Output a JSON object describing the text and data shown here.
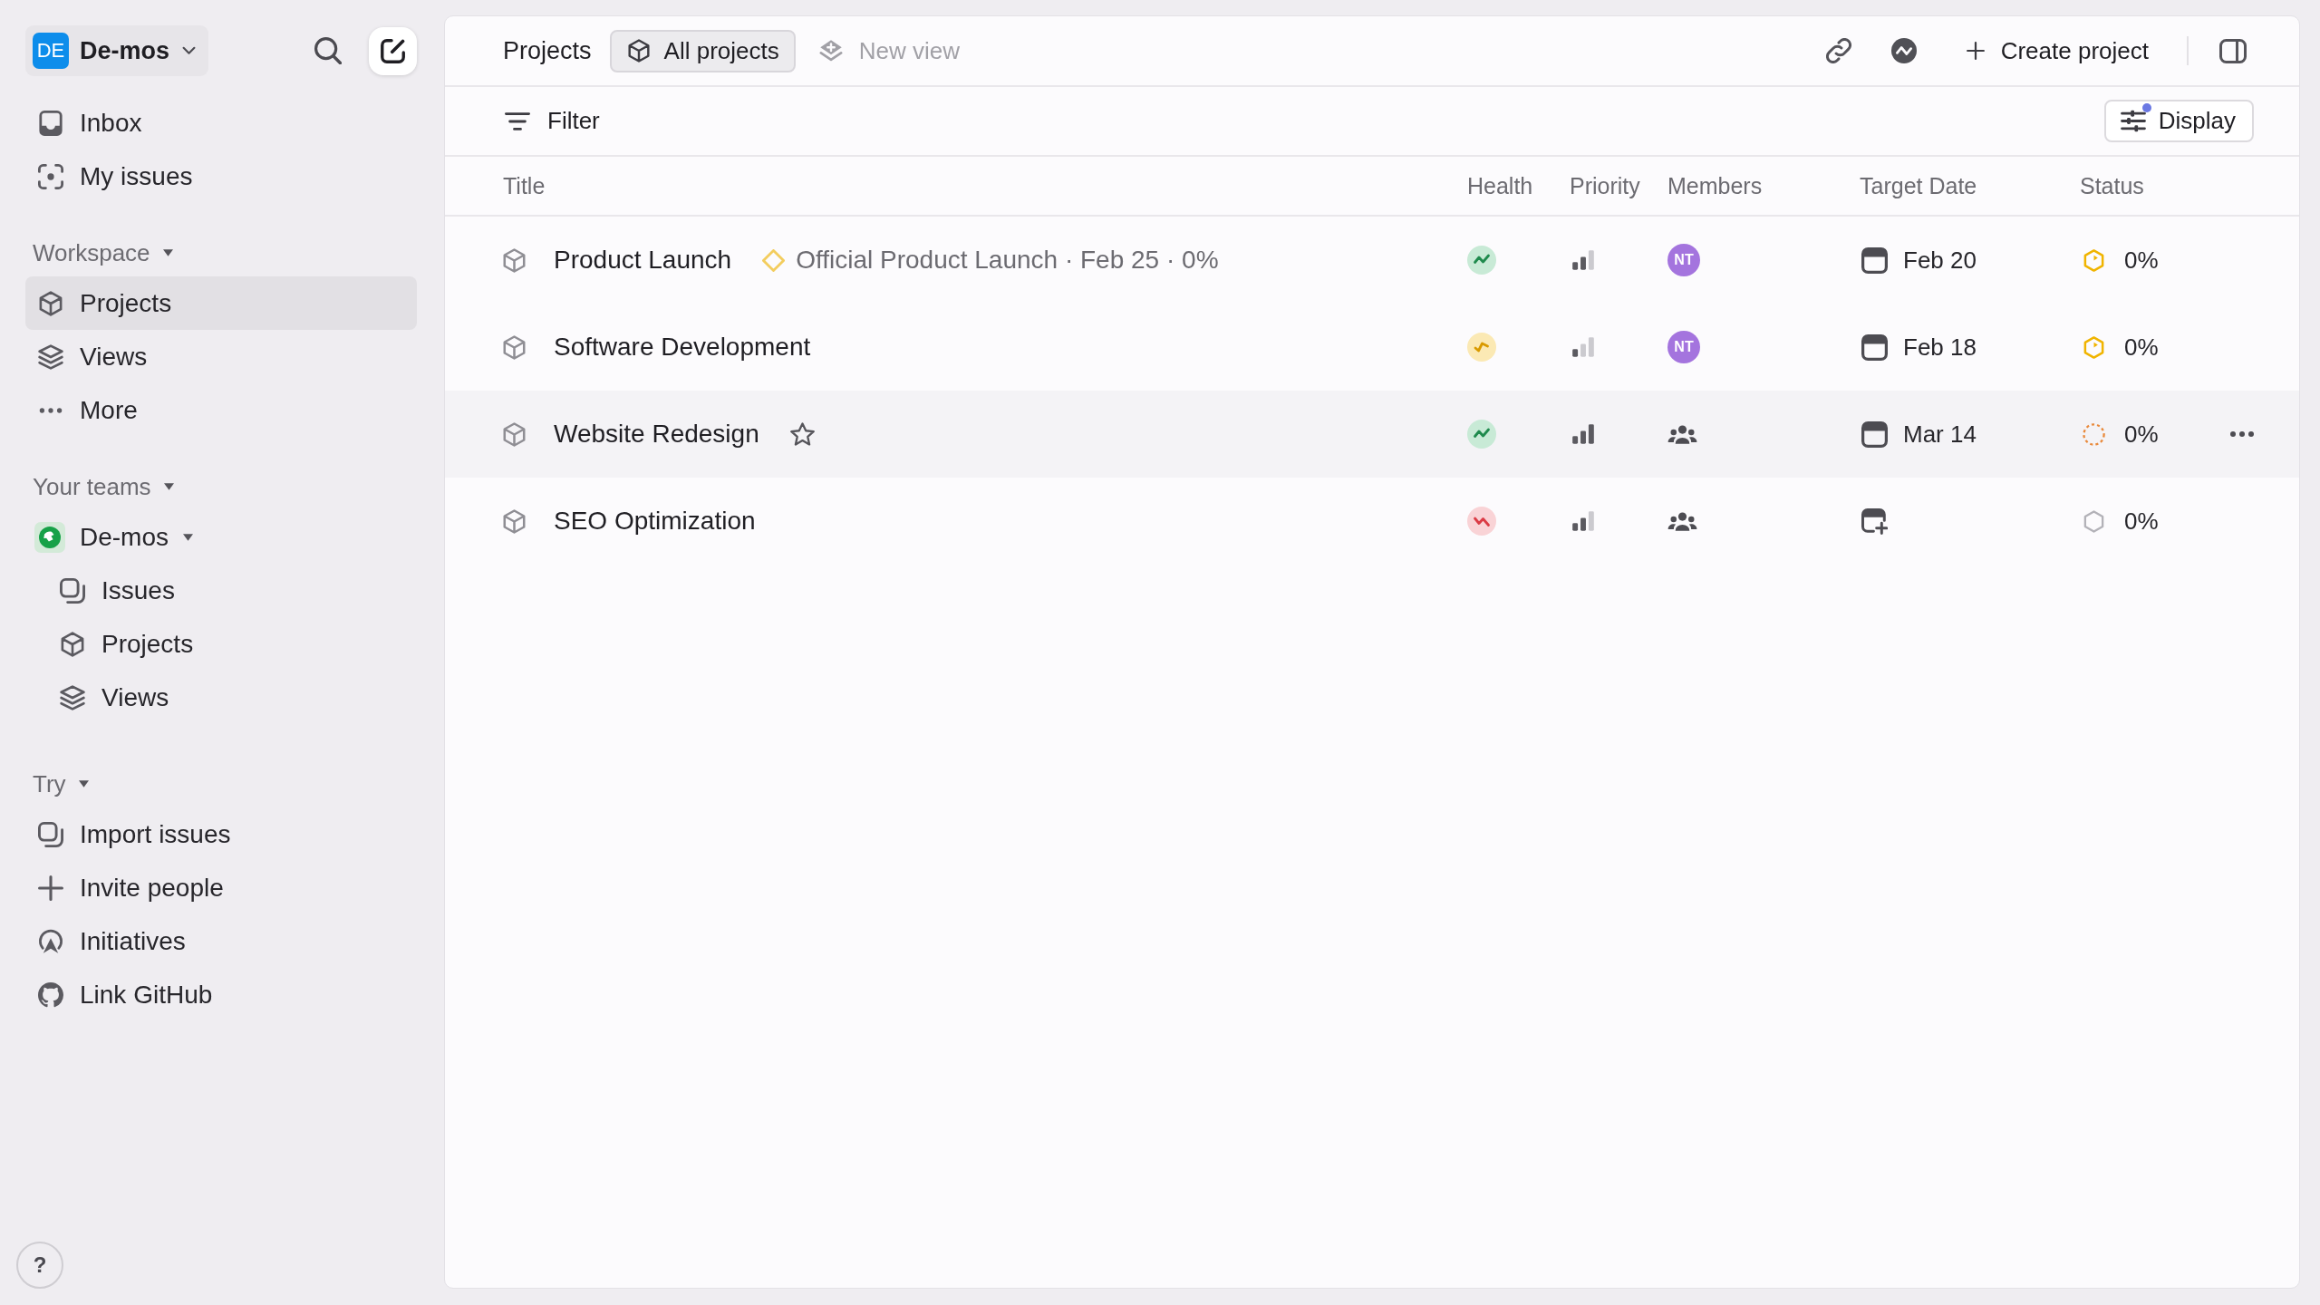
{
  "sidebar": {
    "workspace": {
      "initials": "DE",
      "name": "De-mos"
    },
    "top_items": [
      {
        "kind": "inbox",
        "label": "Inbox",
        "selected": false
      },
      {
        "kind": "my_issues",
        "label": "My issues",
        "selected": false
      }
    ],
    "sections": [
      {
        "title": "Workspace",
        "expanded": true,
        "items": [
          {
            "kind": "projects",
            "label": "Projects",
            "selected": true
          },
          {
            "kind": "views",
            "label": "Views",
            "selected": false
          },
          {
            "kind": "more",
            "label": "More",
            "selected": false
          }
        ]
      },
      {
        "title": "Your teams",
        "expanded": true,
        "items": [
          {
            "kind": "team",
            "label": "De-mos",
            "selected": false,
            "expanded": true,
            "children": [
              {
                "kind": "issues",
                "label": "Issues",
                "selected": false
              },
              {
                "kind": "projects",
                "label": "Projects",
                "selected": false
              },
              {
                "kind": "views",
                "label": "Views",
                "selected": false
              }
            ]
          }
        ]
      },
      {
        "title": "Try",
        "expanded": true,
        "items": [
          {
            "kind": "import",
            "label": "Import issues",
            "selected": false
          },
          {
            "kind": "invite",
            "label": "Invite people",
            "selected": false
          },
          {
            "kind": "initiatives",
            "label": "Initiatives",
            "selected": false
          },
          {
            "kind": "github",
            "label": "Link GitHub",
            "selected": false
          }
        ]
      }
    ],
    "help": "?"
  },
  "toolbar": {
    "title": "Projects",
    "views": [
      {
        "label": "All projects",
        "selected": true
      }
    ],
    "new_view": "New view",
    "create": "Create project"
  },
  "filter_bar": {
    "filter": "Filter",
    "display": {
      "label": "Display",
      "modified": true
    }
  },
  "table": {
    "columns": [
      "Title",
      "Health",
      "Priority",
      "Members",
      "Target Date",
      "Status"
    ],
    "rows": [
      {
        "title": "Product Launch",
        "milestone": "Official Product Launch · Feb 25 · 0%",
        "highlighted": false,
        "health": {
          "kind": "on_track"
        },
        "priority": {
          "kind": "medium"
        },
        "members": {
          "kind": "avatar",
          "initials": "NT"
        },
        "target_date": {
          "kind": "date",
          "text": "Feb 20"
        },
        "status": {
          "kind": "in_progress",
          "text": "0%"
        }
      },
      {
        "title": "Software Development",
        "highlighted": false,
        "health": {
          "kind": "at_risk"
        },
        "priority": {
          "kind": "low"
        },
        "members": {
          "kind": "avatar",
          "initials": "NT"
        },
        "target_date": {
          "kind": "date",
          "text": "Feb 18"
        },
        "status": {
          "kind": "in_progress",
          "text": "0%"
        }
      },
      {
        "title": "Website Redesign",
        "highlighted": true,
        "health": {
          "kind": "on_track"
        },
        "priority": {
          "kind": "high"
        },
        "members": {
          "kind": "team"
        },
        "target_date": {
          "kind": "date",
          "text": "Mar 14"
        },
        "status": {
          "kind": "backlog",
          "text": "0%"
        }
      },
      {
        "title": "SEO Optimization",
        "highlighted": false,
        "health": {
          "kind": "off_track"
        },
        "priority": {
          "kind": "medium"
        },
        "members": {
          "kind": "team"
        },
        "target_date": {
          "kind": "empty"
        },
        "status": {
          "kind": "planned",
          "text": "0%"
        }
      }
    ]
  }
}
